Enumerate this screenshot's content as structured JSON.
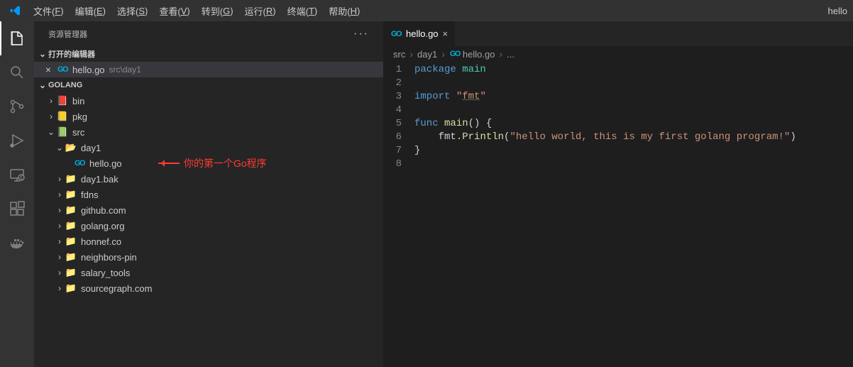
{
  "title_right": "hello",
  "menu": [
    {
      "l": "文件",
      "m": "F"
    },
    {
      "l": "编辑",
      "m": "E"
    },
    {
      "l": "选择",
      "m": "S"
    },
    {
      "l": "查看",
      "m": "V"
    },
    {
      "l": "转到",
      "m": "G"
    },
    {
      "l": "运行",
      "m": "R"
    },
    {
      "l": "终端",
      "m": "T"
    },
    {
      "l": "帮助",
      "m": "H"
    }
  ],
  "sidebar": {
    "title": "资源管理器",
    "open_editors": "打开的编辑器",
    "open_file": {
      "name": "hello.go",
      "path": "src\\day1"
    },
    "project": "GOLANG",
    "annotation": "你的第一个Go程序",
    "tree": [
      {
        "chev": "right",
        "indent": 1,
        "icon": "folder-red",
        "label": "bin"
      },
      {
        "chev": "right",
        "indent": 1,
        "icon": "folder-yellow",
        "label": "pkg"
      },
      {
        "chev": "down",
        "indent": 1,
        "icon": "folder-green",
        "label": "src"
      },
      {
        "chev": "down",
        "indent": 2,
        "icon": "folder-open",
        "label": "day1"
      },
      {
        "chev": "none",
        "indent": 3,
        "icon": "go",
        "label": "hello.go",
        "annotated": true
      },
      {
        "chev": "right",
        "indent": 2,
        "icon": "folder",
        "label": "day1.bak"
      },
      {
        "chev": "right",
        "indent": 2,
        "icon": "folder",
        "label": "fdns"
      },
      {
        "chev": "right",
        "indent": 2,
        "icon": "folder",
        "label": "github.com"
      },
      {
        "chev": "right",
        "indent": 2,
        "icon": "folder",
        "label": "golang.org"
      },
      {
        "chev": "right",
        "indent": 2,
        "icon": "folder",
        "label": "honnef.co"
      },
      {
        "chev": "right",
        "indent": 2,
        "icon": "folder",
        "label": "neighbors-pin"
      },
      {
        "chev": "right",
        "indent": 2,
        "icon": "folder",
        "label": "salary_tools"
      },
      {
        "chev": "right",
        "indent": 2,
        "icon": "folder",
        "label": "sourcegraph.com"
      }
    ]
  },
  "tab": {
    "name": "hello.go"
  },
  "breadcrumb": [
    "src",
    "day1",
    "hello.go",
    "..."
  ],
  "code": [
    [
      {
        "t": "package ",
        "c": "kw"
      },
      {
        "t": "main",
        "c": "pkg"
      }
    ],
    [],
    [
      {
        "t": "import ",
        "c": "kw"
      },
      {
        "t": "\"",
        "c": "str"
      },
      {
        "t": "fmt",
        "c": "str-u"
      },
      {
        "t": "\"",
        "c": "str"
      }
    ],
    [],
    [
      {
        "t": "func ",
        "c": "kw"
      },
      {
        "t": "main",
        "c": "fn"
      },
      {
        "t": "() {",
        "c": "id"
      }
    ],
    [
      {
        "t": "    ",
        "c": "id"
      },
      {
        "t": "fmt",
        "c": "id"
      },
      {
        "t": ".",
        "c": "id"
      },
      {
        "t": "Println",
        "c": "fn"
      },
      {
        "t": "(",
        "c": "id"
      },
      {
        "t": "\"hello world, this is my first golang program!\"",
        "c": "str"
      },
      {
        "t": ")",
        "c": "id"
      }
    ],
    [
      {
        "t": "}",
        "c": "id"
      }
    ],
    []
  ]
}
